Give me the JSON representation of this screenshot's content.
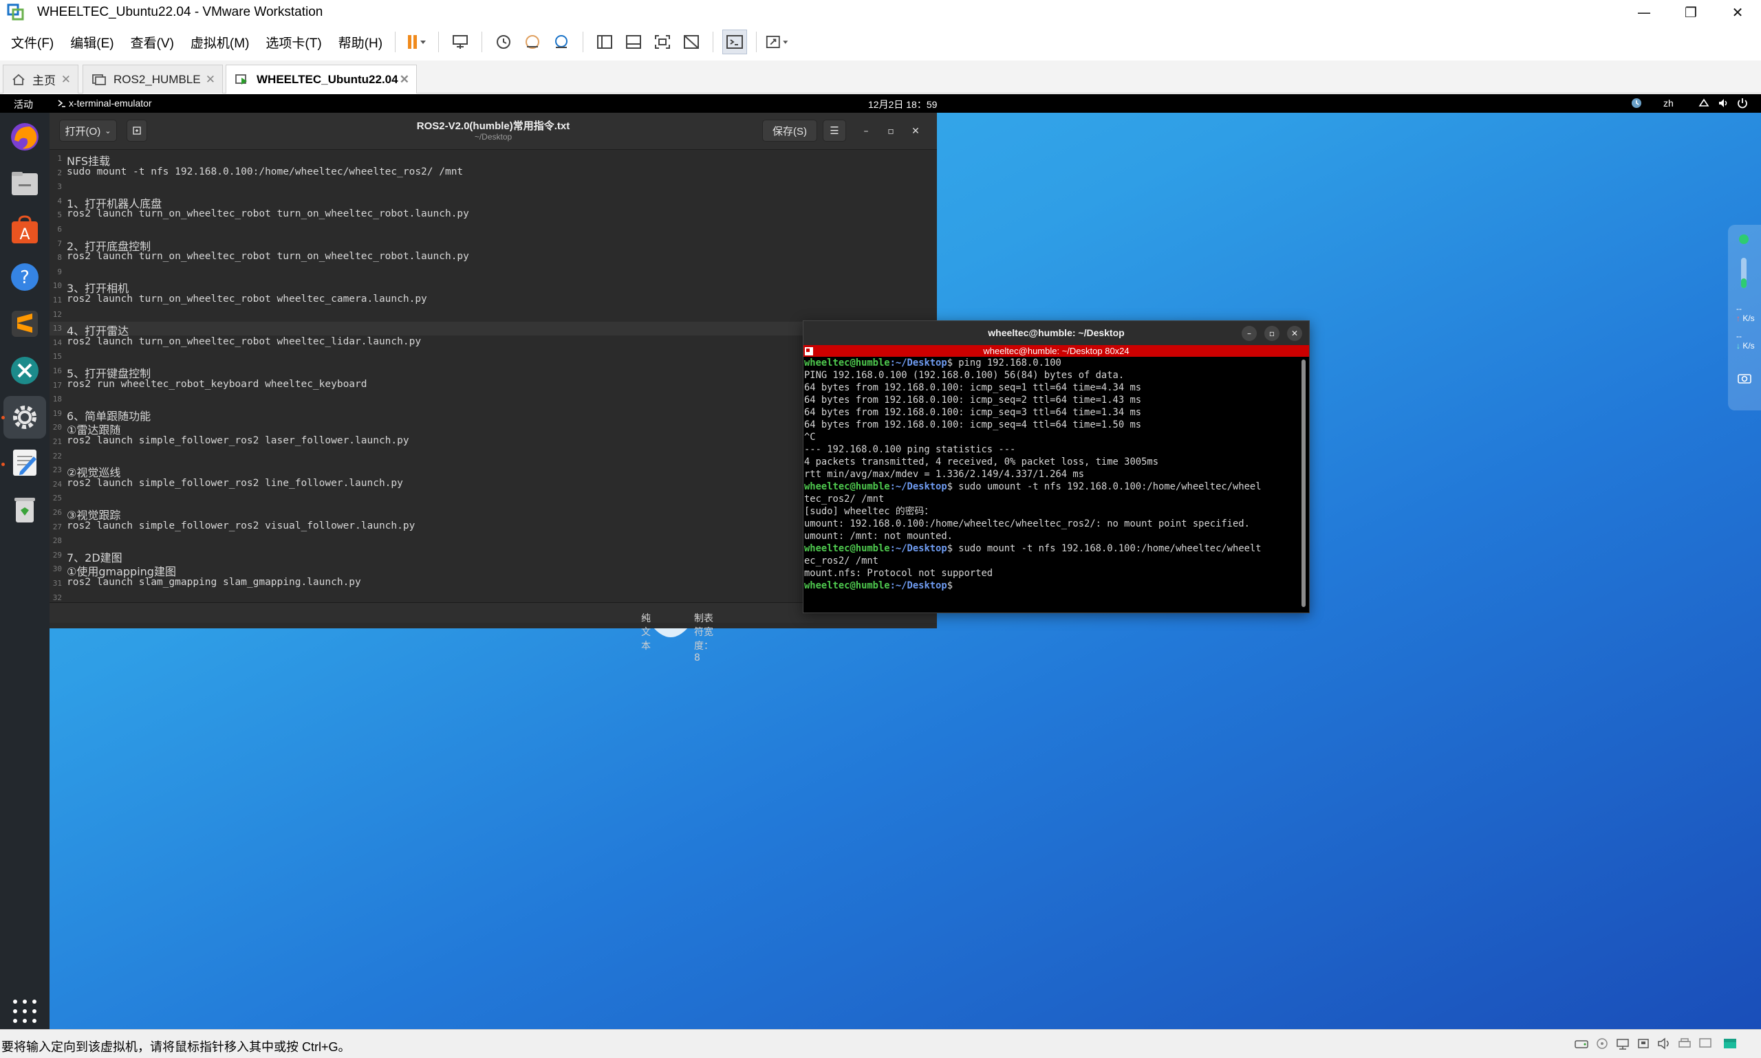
{
  "window": {
    "title": "WHEELTEC_Ubuntu22.04 - VMware Workstation",
    "minimize": "—",
    "maximize": "❐",
    "close": "✕"
  },
  "menu": {
    "file": "文件(F)",
    "edit": "编辑(E)",
    "view": "查看(V)",
    "vm": "虚拟机(M)",
    "tabs": "选项卡(T)",
    "help": "帮助(H)"
  },
  "tabs": [
    {
      "label": "主页"
    },
    {
      "label": "ROS2_HUMBLE"
    },
    {
      "label": "WHEELTEC_Ubuntu22.04"
    }
  ],
  "topbar": {
    "activities": "活动",
    "app_menu": "x-terminal-emulator",
    "clock": "12月2日 18：59",
    "lang": "zh"
  },
  "gedit": {
    "open_label": "打开(O)",
    "title": "ROS2-V2.0(humble)常用指令.txt",
    "subtitle": "~/Desktop",
    "save_label": "保存(S)",
    "menu_glyph": "☰",
    "lines": [
      {
        "n": "1",
        "t": "NFS挂载"
      },
      {
        "n": "2",
        "t": "sudo mount -t nfs 192.168.0.100:/home/wheeltec/wheeltec_ros2/ /mnt"
      },
      {
        "n": "3",
        "t": ""
      },
      {
        "n": "4",
        "t": "1、打开机器人底盘"
      },
      {
        "n": "5",
        "t": "ros2 launch turn_on_wheeltec_robot turn_on_wheeltec_robot.launch.py"
      },
      {
        "n": "6",
        "t": ""
      },
      {
        "n": "7",
        "t": "2、打开底盘控制"
      },
      {
        "n": "8",
        "t": "ros2 launch turn_on_wheeltec_robot turn_on_wheeltec_robot.launch.py"
      },
      {
        "n": "9",
        "t": ""
      },
      {
        "n": "10",
        "t": "3、打开相机"
      },
      {
        "n": "11",
        "t": "ros2 launch turn_on_wheeltec_robot wheeltec_camera.launch.py"
      },
      {
        "n": "12",
        "t": ""
      },
      {
        "n": "13",
        "t": "4、打开雷达"
      },
      {
        "n": "14",
        "t": "ros2 launch turn_on_wheeltec_robot wheeltec_lidar.launch.py"
      },
      {
        "n": "15",
        "t": ""
      },
      {
        "n": "16",
        "t": "5、打开键盘控制"
      },
      {
        "n": "17",
        "t": "ros2 run wheeltec_robot_keyboard wheeltec_keyboard"
      },
      {
        "n": "18",
        "t": ""
      },
      {
        "n": "19",
        "t": "6、简单跟随功能"
      },
      {
        "n": "20",
        "t": "①雷达跟随"
      },
      {
        "n": "21",
        "t": "ros2 launch simple_follower_ros2 laser_follower.launch.py"
      },
      {
        "n": "22",
        "t": ""
      },
      {
        "n": "23",
        "t": "②视觉巡线"
      },
      {
        "n": "24",
        "t": "ros2 launch simple_follower_ros2 line_follower.launch.py"
      },
      {
        "n": "25",
        "t": ""
      },
      {
        "n": "26",
        "t": "③视觉跟踪"
      },
      {
        "n": "27",
        "t": "ros2 launch simple_follower_ros2 visual_follower.launch.py"
      },
      {
        "n": "28",
        "t": ""
      },
      {
        "n": "29",
        "t": "7、2D建图"
      },
      {
        "n": "30",
        "t": "①使用gmapping建图"
      },
      {
        "n": "31",
        "t": "ros2 launch slam_gmapping slam_gmapping.launch.py"
      },
      {
        "n": "32",
        "t": ""
      }
    ],
    "status": {
      "mode": "纯文本",
      "tab_width": "制表符宽度： 8"
    }
  },
  "terminal": {
    "title": "wheeltec@humble: ~/Desktop",
    "size_bar": "wheeltec@humble: ~/Desktop 80x24",
    "prompt_user": "wheeltec@humble",
    "prompt_path": ":~/Desktop",
    "lines": [
      {
        "user": "wheeltec@humble",
        "path": ":~/Desktop",
        "cmd": "$ ping 192.168.0.100"
      },
      {
        "text": "PING 192.168.0.100 (192.168.0.100) 56(84) bytes of data."
      },
      {
        "text": "64 bytes from 192.168.0.100: icmp_seq=1 ttl=64 time=4.34 ms"
      },
      {
        "text": "64 bytes from 192.168.0.100: icmp_seq=2 ttl=64 time=1.43 ms"
      },
      {
        "text": "64 bytes from 192.168.0.100: icmp_seq=3 ttl=64 time=1.34 ms"
      },
      {
        "text": "64 bytes from 192.168.0.100: icmp_seq=4 ttl=64 time=1.50 ms"
      },
      {
        "text": "^C"
      },
      {
        "text": "--- 192.168.0.100 ping statistics ---"
      },
      {
        "text": "4 packets transmitted, 4 received, 0% packet loss, time 3005ms"
      },
      {
        "text": "rtt min/avg/max/mdev = 1.336/2.149/4.337/1.264 ms"
      },
      {
        "user": "wheeltec@humble",
        "path": ":~/Desktop",
        "cmd": "$ sudo umount -t nfs 192.168.0.100:/home/wheeltec/wheel"
      },
      {
        "text": "tec_ros2/ /mnt"
      },
      {
        "text": "[sudo] wheeltec 的密码："
      },
      {
        "text": "umount: 192.168.0.100:/home/wheeltec/wheeltec_ros2/: no mount point specified."
      },
      {
        "text": "umount: /mnt: not mounted."
      },
      {
        "user": "wheeltec@humble",
        "path": ":~/Desktop",
        "cmd": "$ sudo mount -t nfs 192.168.0.100:/home/wheeltec/wheelt"
      },
      {
        "text": "ec_ros2/ /mnt"
      },
      {
        "text": "mount.nfs: Protocol not supported"
      },
      {
        "user": "wheeltec@humble",
        "path": ":~/Desktop",
        "cmd": "$ "
      }
    ]
  },
  "net_widget": {
    "up": "K/s",
    "down": "K/s",
    "dash1": "--",
    "dash2": "--"
  },
  "statusbar": {
    "message": "要将输入定向到该虚拟机，请将鼠标指针移入其中或按 Ctrl+G。"
  },
  "colors": {
    "gedit_bg": "#2b2b2b",
    "terminal_bg": "#000000",
    "terminal_size_bar": "#cc0000",
    "prompt_green": "#4ec94e",
    "prompt_blue": "#6f9cf2",
    "dock_bg": "#23282d"
  }
}
